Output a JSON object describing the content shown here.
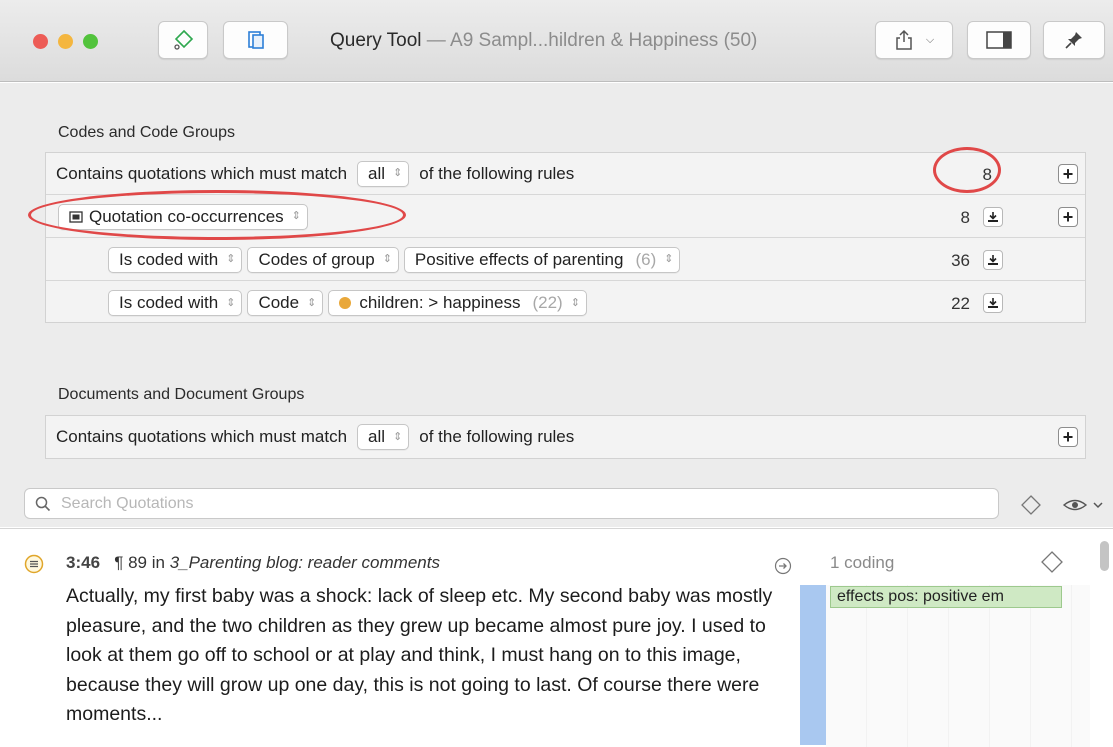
{
  "window": {
    "title": "Query Tool",
    "subtitle": " — A9 Sampl...hildren & Happiness (50)",
    "traffic_lights": [
      "#ed5c56",
      "#f4b63f",
      "#52c33c"
    ]
  },
  "codes_section": {
    "title": "Codes and Code Groups",
    "header_rule": {
      "prefix": "Contains quotations which must match",
      "match": "all",
      "suffix": "of the following rules",
      "count": "8"
    },
    "operator": {
      "label": "Quotation co-occurrences",
      "count": "8"
    },
    "rules": [
      {
        "condition": "Is coded with",
        "target": "Codes of group",
        "value": "Positive effects of parenting",
        "value_count": "(6)",
        "count": "36"
      },
      {
        "condition": "Is coded with",
        "target": "Code",
        "value": "children: > happiness",
        "value_count": "(22)",
        "value_color": "#e9a83a",
        "count": "22"
      }
    ]
  },
  "documents_section": {
    "title": "Documents and Document Groups",
    "header_rule": {
      "prefix": "Contains quotations which must match",
      "match": "all",
      "suffix": "of the following rules"
    }
  },
  "search": {
    "placeholder": "Search Quotations",
    "value": ""
  },
  "result": {
    "id": "3:46",
    "para_mark": "¶",
    "para": "89 in",
    "document": "3_Parenting blog: reader comments",
    "text": "Actually, my first baby was a shock: lack of sleep etc. My second baby was mostly pleasure, and the two children as they grew up became almost pure joy. I used to look at them go off to school or at play and think, I must hang on to this image, because they will grow up one day, this is not going to last. Of course there were moments...",
    "coding_count": "1 coding",
    "code_tag": "effects pos: positive em",
    "code_tag_color": "#cfe9c4"
  }
}
